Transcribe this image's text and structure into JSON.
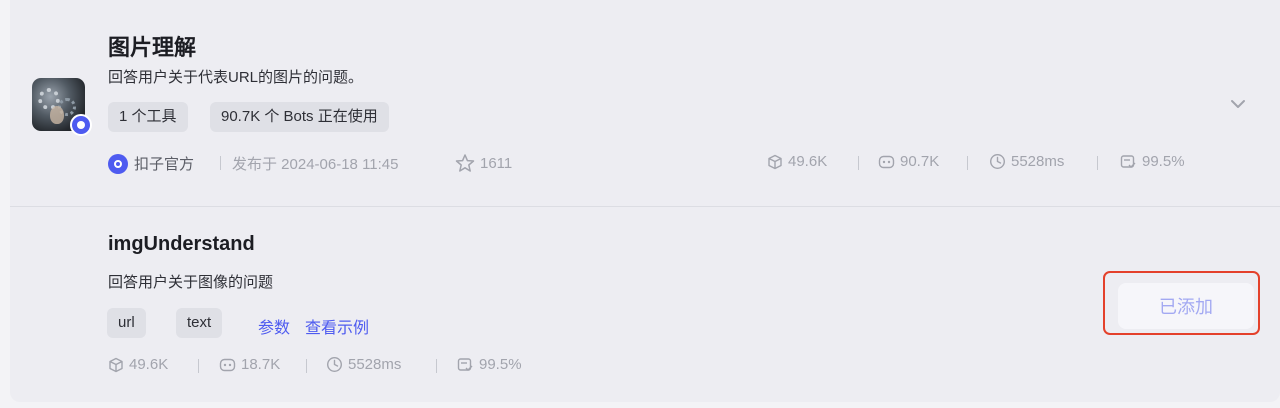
{
  "plugin": {
    "title": "图片理解",
    "description": "回答用户关于代表URL的图片的问题。",
    "chips": [
      "1 个工具",
      "90.7K 个 Bots 正在使用"
    ],
    "author": "扣子官方",
    "published": "发布于 2024-06-18 11:45",
    "favorites": "1611",
    "stats": {
      "cost": "49.6K",
      "calls": "90.7K",
      "latency": "5528ms",
      "success": "99.5%"
    }
  },
  "tool": {
    "title": "imgUnderstand",
    "description": "回答用户关于图像的问题",
    "params": [
      "url",
      "text"
    ],
    "links": [
      "参数",
      "查看示例"
    ],
    "stats": {
      "cost": "49.6K",
      "calls": "18.7K",
      "latency": "5528ms",
      "success": "99.5%"
    },
    "added_label": "已添加"
  },
  "colors": {
    "accent": "#4e5bf0",
    "highlight_border": "#e4412b",
    "muted_text": "#a2a4ad"
  }
}
